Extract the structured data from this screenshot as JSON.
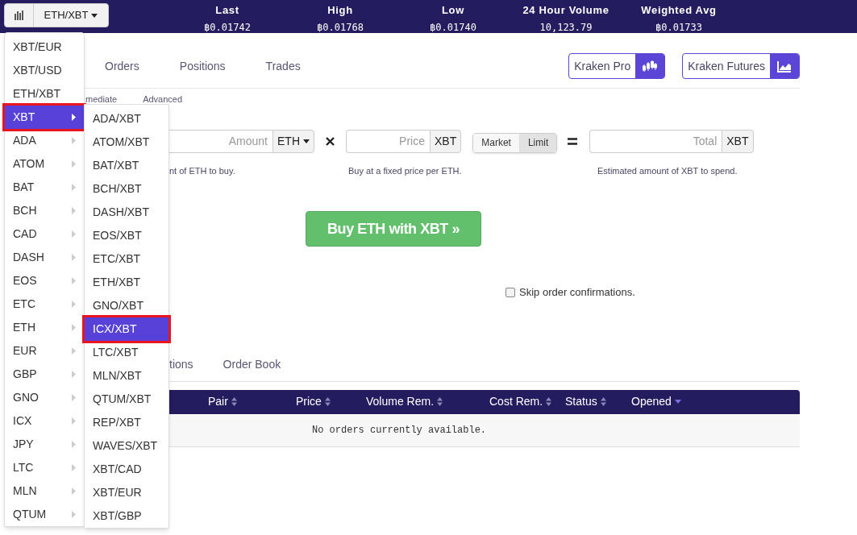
{
  "top_bar": {
    "pair_selector": "ETH/XBT",
    "stats": [
      {
        "label": "Last",
        "value": "฿0.01742"
      },
      {
        "label": "High",
        "value": "฿0.01768"
      },
      {
        "label": "Low",
        "value": "฿0.01740"
      },
      {
        "label": "24 Hour Volume",
        "value": "10,123.79"
      },
      {
        "label": "Weighted Avg",
        "value": "฿0.01733"
      }
    ]
  },
  "main_tabs": [
    {
      "label": "Orders"
    },
    {
      "label": "Positions"
    },
    {
      "label": "Trades"
    }
  ],
  "platform_links": [
    {
      "label": "Kraken Pro",
      "kind": "candles"
    },
    {
      "label": "Kraken Futures",
      "kind": "line"
    }
  ],
  "order_type_tabs": [
    {
      "label": "mediate"
    },
    {
      "label": "Advanced"
    }
  ],
  "form": {
    "amount_placeholder": "Amount",
    "amount_currency": "ETH",
    "price_placeholder": "Price",
    "price_currency": "XBT",
    "modes": [
      {
        "label": "Market",
        "selected": false
      },
      {
        "label": "Limit",
        "selected": true
      }
    ],
    "total_placeholder": "Total",
    "total_currency": "XBT",
    "hints": [
      "nt of ETH to buy.",
      "Buy at a fixed price per ETH.",
      "Estimated amount of XBT to spend."
    ]
  },
  "buy_button": "Buy ETH with XBT »",
  "skip_confirmations": {
    "label": "Skip order confirmations.",
    "checked": false
  },
  "lower_tabs": [
    {
      "label": "tions"
    },
    {
      "label": "Order Book"
    }
  ],
  "orders_table": {
    "columns": [
      {
        "label": "Pair",
        "sorted": false
      },
      {
        "label": "Price",
        "sorted": false
      },
      {
        "label": "Volume Rem.",
        "sorted": false
      },
      {
        "label": "Cost Rem.",
        "sorted": false
      },
      {
        "label": "Status",
        "sorted": false
      },
      {
        "label": "Opened",
        "sorted": true
      }
    ],
    "empty_message": "No orders currently available."
  },
  "pair_menu": [
    {
      "label": "XBT/EUR",
      "kind": "pair",
      "selected": false
    },
    {
      "label": "XBT/USD",
      "kind": "pair",
      "selected": false
    },
    {
      "label": "ETH/XBT",
      "kind": "pair",
      "selected": false
    },
    {
      "label": "XBT",
      "kind": "group",
      "selected": true
    },
    {
      "label": "ADA",
      "kind": "group",
      "selected": false
    },
    {
      "label": "ATOM",
      "kind": "group",
      "selected": false
    },
    {
      "label": "BAT",
      "kind": "group",
      "selected": false
    },
    {
      "label": "BCH",
      "kind": "group",
      "selected": false
    },
    {
      "label": "CAD",
      "kind": "group",
      "selected": false
    },
    {
      "label": "DASH",
      "kind": "group",
      "selected": false
    },
    {
      "label": "EOS",
      "kind": "group",
      "selected": false
    },
    {
      "label": "ETC",
      "kind": "group",
      "selected": false
    },
    {
      "label": "ETH",
      "kind": "group",
      "selected": false
    },
    {
      "label": "EUR",
      "kind": "group",
      "selected": false
    },
    {
      "label": "GBP",
      "kind": "group",
      "selected": false
    },
    {
      "label": "GNO",
      "kind": "group",
      "selected": false
    },
    {
      "label": "ICX",
      "kind": "group",
      "selected": false
    },
    {
      "label": "JPY",
      "kind": "group",
      "selected": false
    },
    {
      "label": "LTC",
      "kind": "group",
      "selected": false
    },
    {
      "label": "MLN",
      "kind": "group",
      "selected": false
    },
    {
      "label": "QTUM",
      "kind": "group",
      "selected": false
    }
  ],
  "sub_menu": [
    {
      "label": "ADA/XBT",
      "selected": false
    },
    {
      "label": "ATOM/XBT",
      "selected": false
    },
    {
      "label": "BAT/XBT",
      "selected": false
    },
    {
      "label": "BCH/XBT",
      "selected": false
    },
    {
      "label": "DASH/XBT",
      "selected": false
    },
    {
      "label": "EOS/XBT",
      "selected": false
    },
    {
      "label": "ETC/XBT",
      "selected": false
    },
    {
      "label": "ETH/XBT",
      "selected": false
    },
    {
      "label": "GNO/XBT",
      "selected": false
    },
    {
      "label": "ICX/XBT",
      "selected": true
    },
    {
      "label": "LTC/XBT",
      "selected": false
    },
    {
      "label": "MLN/XBT",
      "selected": false
    },
    {
      "label": "QTUM/XBT",
      "selected": false
    },
    {
      "label": "REP/XBT",
      "selected": false
    },
    {
      "label": "WAVES/XBT",
      "selected": false
    },
    {
      "label": "XBT/CAD",
      "selected": false
    },
    {
      "label": "XBT/EUR",
      "selected": false
    },
    {
      "label": "XBT/GBP",
      "selected": false
    }
  ]
}
